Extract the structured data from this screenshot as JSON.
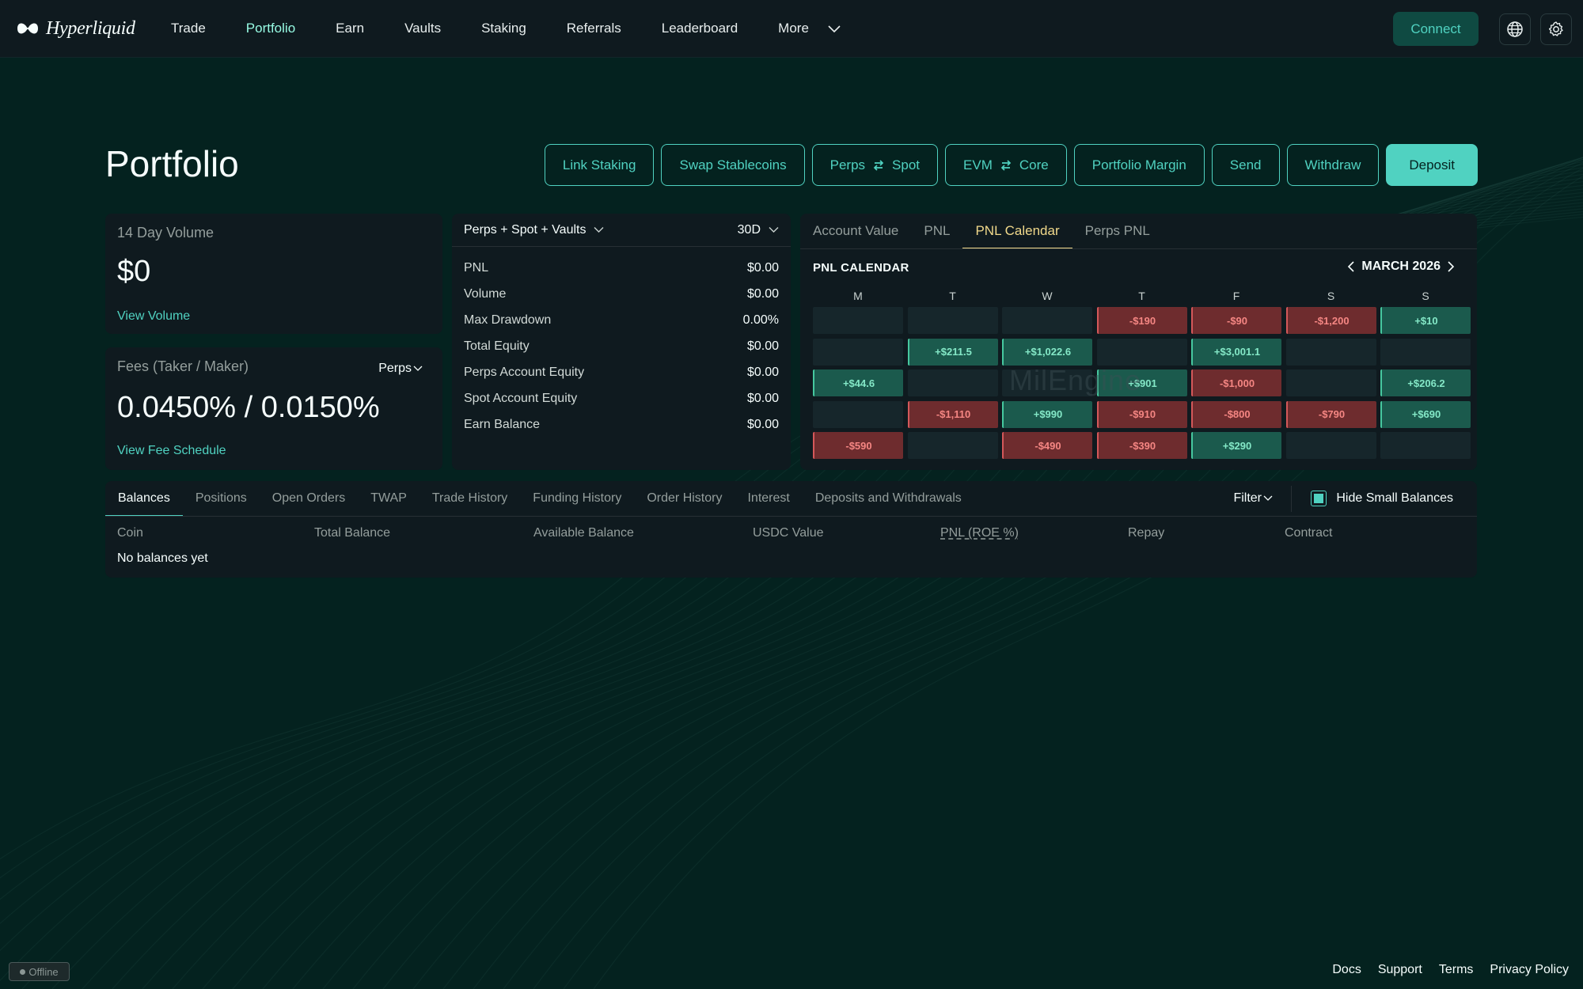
{
  "nav": {
    "brand": "Hyperliquid",
    "links": [
      {
        "label": "Trade",
        "active": false
      },
      {
        "label": "Portfolio",
        "active": true
      },
      {
        "label": "Earn",
        "active": false
      },
      {
        "label": "Vaults",
        "active": false
      },
      {
        "label": "Staking",
        "active": false
      },
      {
        "label": "Referrals",
        "active": false
      },
      {
        "label": "Leaderboard",
        "active": false
      },
      {
        "label": "More",
        "active": false
      }
    ],
    "connect_label": "Connect"
  },
  "page": {
    "title": "Portfolio",
    "actions": {
      "link_staking": "Link Staking",
      "swap_stablecoins": "Swap Stablecoins",
      "perps": "Perps",
      "spot": "Spot",
      "evm": "EVM",
      "core": "Core",
      "portfolio_margin": "Portfolio Margin",
      "send": "Send",
      "withdraw": "Withdraw",
      "deposit": "Deposit"
    }
  },
  "volume": {
    "label": "14 Day Volume",
    "value": "$0",
    "link": "View Volume"
  },
  "fees": {
    "label": "Fees (Taker / Maker)",
    "selector": "Perps",
    "value": "0.0450% / 0.0150%",
    "link": "View Fee Schedule"
  },
  "stats": {
    "scope": "Perps + Spot + Vaults",
    "period": "30D",
    "rows": [
      {
        "label": "PNL",
        "value": "$0.00"
      },
      {
        "label": "Volume",
        "value": "$0.00"
      },
      {
        "label": "Max Drawdown",
        "value": "0.00%"
      },
      {
        "label": "Total Equity",
        "value": "$0.00"
      },
      {
        "label": "Perps Account Equity",
        "value": "$0.00"
      },
      {
        "label": "Spot Account Equity",
        "value": "$0.00"
      },
      {
        "label": "Earn Balance",
        "value": "$0.00"
      }
    ]
  },
  "calendar": {
    "tabs": [
      "Account Value",
      "PNL",
      "PNL Calendar",
      "Perps PNL"
    ],
    "active_tab": "PNL Calendar",
    "title": "PNL CALENDAR",
    "month": "MARCH 2026",
    "days": [
      "M",
      "T",
      "W",
      "T",
      "F",
      "S",
      "S"
    ],
    "watermark": "MilEngine",
    "weeks": [
      [
        "",
        "",
        "",
        "-$190",
        "-$90",
        "-$1,200",
        "+$10"
      ],
      [
        "",
        "+$211.5",
        "+$1,022.6",
        "",
        "+$3,001.1",
        "",
        ""
      ],
      [
        "+$44.6",
        "",
        "",
        "+$901",
        "-$1,000",
        "",
        "+$206.2"
      ],
      [
        "",
        "-$1,110",
        "+$990",
        "-$910",
        "-$800",
        "-$790",
        "+$690"
      ],
      [
        "-$590",
        "",
        "-$490",
        "-$390",
        "+$290",
        "",
        ""
      ]
    ],
    "colors": {
      "positive": "#1b5a4d",
      "negative": "#6e2c2e",
      "empty": "#16262b"
    }
  },
  "balances": {
    "tabs": [
      "Balances",
      "Positions",
      "Open Orders",
      "TWAP",
      "Trade History",
      "Funding History",
      "Order History",
      "Interest",
      "Deposits and Withdrawals"
    ],
    "active_tab": "Balances",
    "filter": "Filter",
    "hide_small": "Hide Small Balances",
    "hide_small_checked": true,
    "columns": [
      "Coin",
      "Total Balance",
      "Available Balance",
      "USDC Value",
      "PNL (ROE %)",
      "Repay",
      "Contract"
    ],
    "empty": "No balances yet"
  },
  "footer": {
    "status": "Offline",
    "links": [
      "Docs",
      "Support",
      "Terms",
      "Privacy Policy"
    ]
  },
  "theme": {
    "accent": "#50d2c1",
    "background": "#04221f",
    "panel": "#0f1a1f",
    "active_tab": "#f1d98b"
  }
}
